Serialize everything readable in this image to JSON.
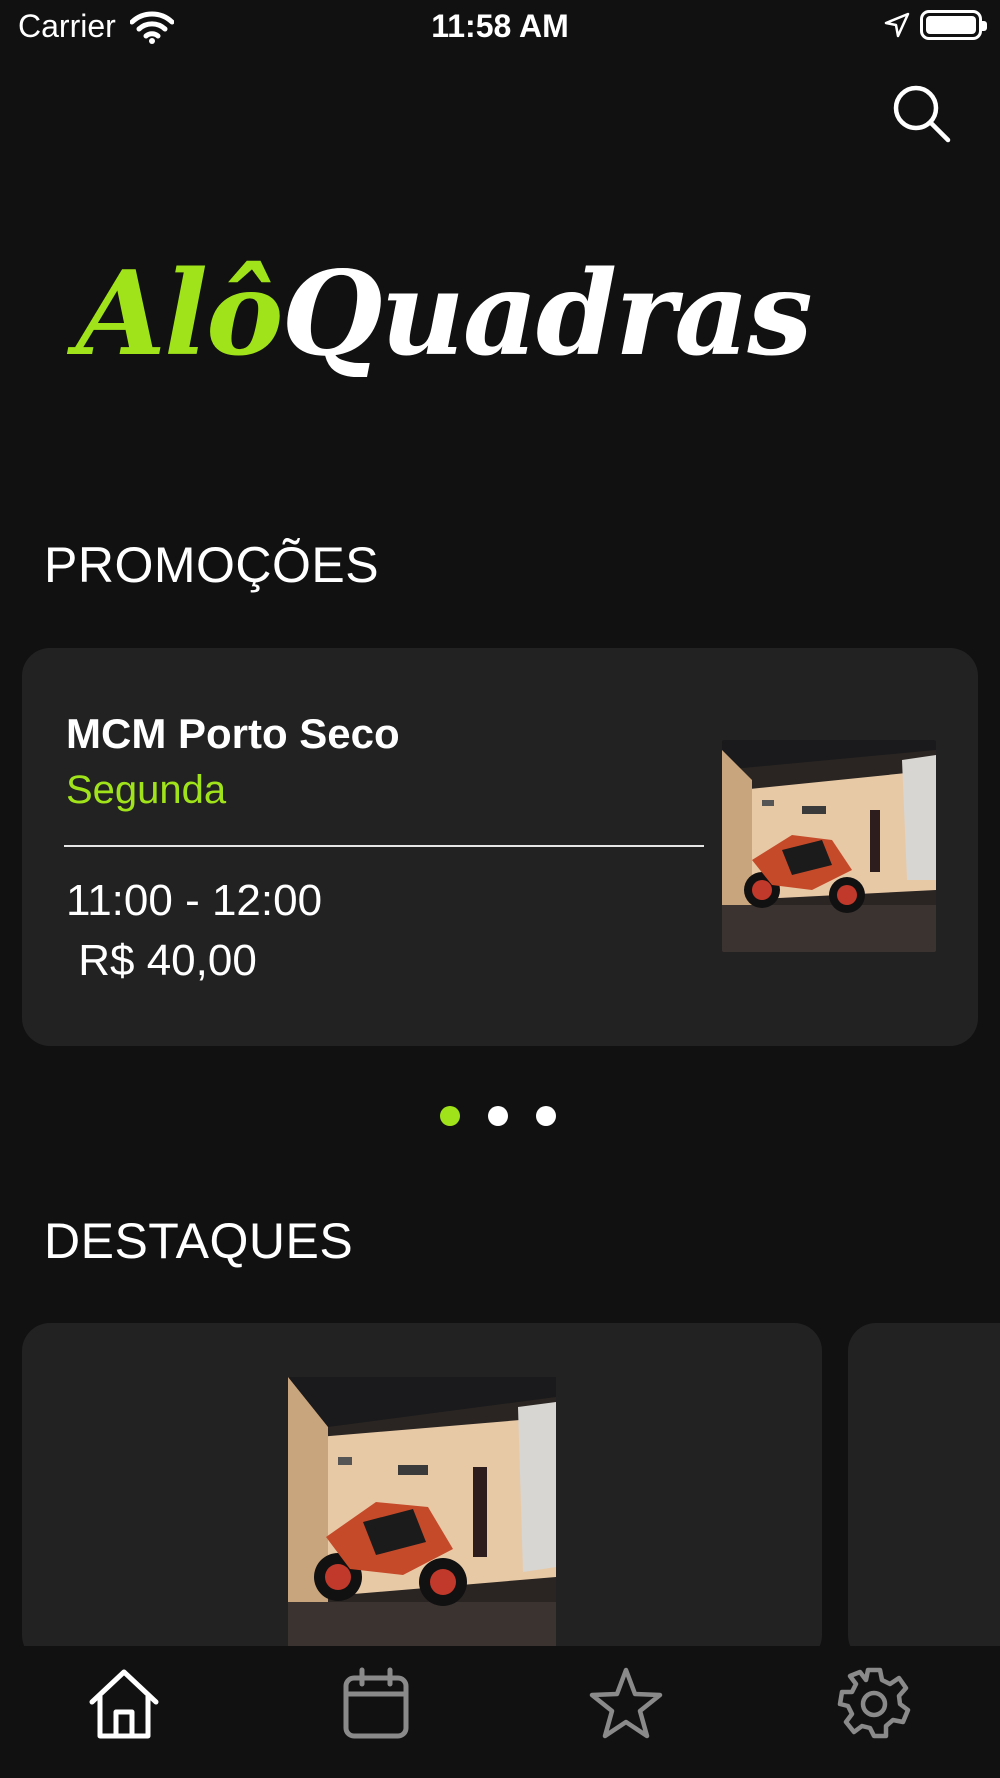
{
  "status_bar": {
    "carrier": "Carrier",
    "time": "11:58 AM"
  },
  "header": {
    "search_icon": "search-icon"
  },
  "logo": {
    "part1": "Alô",
    "part2": "Quadras"
  },
  "promotions": {
    "title": "PROMOÇÕES",
    "card": {
      "name": "MCM Porto Seco",
      "day": "Segunda",
      "time": "11:00 - 12:00",
      "price": " R$ 40,00"
    },
    "pagination": {
      "total": 3,
      "active_index": 0
    }
  },
  "highlights": {
    "title": "DESTAQUES"
  },
  "tab_bar": {
    "items": [
      {
        "icon": "home-icon",
        "active": true
      },
      {
        "icon": "calendar-icon",
        "active": false
      },
      {
        "icon": "star-icon",
        "active": false
      },
      {
        "icon": "gear-icon",
        "active": false
      }
    ]
  },
  "colors": {
    "accent": "#a0e31b",
    "background": "#111111",
    "card": "#222222",
    "inactive_icon": "#8a8a8a"
  }
}
